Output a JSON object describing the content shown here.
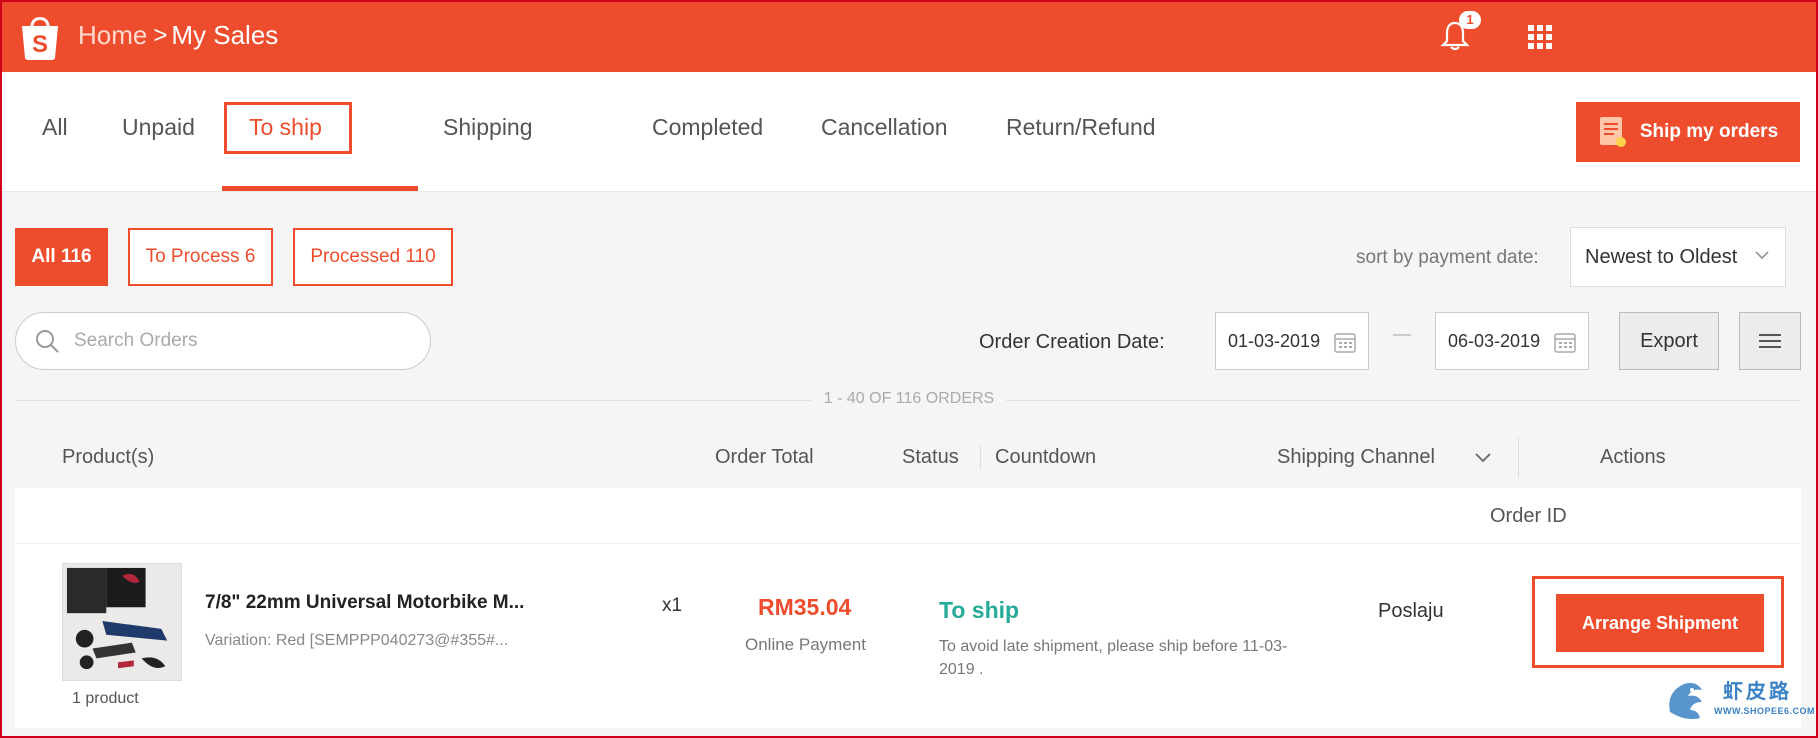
{
  "topbar": {
    "logo_letter": "S",
    "breadcrumb_home": "Home",
    "breadcrumb_separator": ">",
    "breadcrumb_current": "My Sales",
    "notification_count": "1",
    "brand_color": "#ee4d2d"
  },
  "tabs": [
    {
      "label": "All"
    },
    {
      "label": "Unpaid"
    },
    {
      "label": "To ship"
    },
    {
      "label": "Shipping"
    },
    {
      "label": "Completed"
    },
    {
      "label": "Cancellation"
    },
    {
      "label": "Return/Refund"
    }
  ],
  "active_tab": "To ship",
  "ship_orders_button": "Ship my orders",
  "filters": {
    "chips": [
      {
        "label": "All 116"
      },
      {
        "label": "To Process 6"
      },
      {
        "label": "Processed 110"
      }
    ],
    "sort_label": "sort by payment date:",
    "sort_value": "Newest to Oldest",
    "search_placeholder": "Search Orders",
    "date_label": "Order Creation Date:",
    "date_from": "01-03-2019",
    "date_to": "06-03-2019",
    "export_label": "Export"
  },
  "orders_count": "1 - 40 OF 116 ORDERS",
  "columns": {
    "product": "Product(s)",
    "order_total": "Order Total",
    "status": "Status",
    "countdown": "Countdown",
    "shipping_channel": "Shipping Channel",
    "actions": "Actions"
  },
  "order": {
    "order_id_label": "Order ID",
    "product_name": "7/8\" 22mm Universal Motorbike M...",
    "variation": "Variation: Red [SEMPPP040273@#355#...",
    "product_count": "1 product",
    "quantity": "x1",
    "total": "RM35.04",
    "payment_method": "Online Payment",
    "status": "To ship",
    "status_note": "To avoid late shipment, please ship before 11-03-2019 .",
    "shipping_channel": "Poslaju",
    "action_label": "Arrange Shipment",
    "status_color": "#26aa99"
  },
  "watermark": {
    "chinese": "虾皮路",
    "url": "WWW.SHOPEE6.COM"
  }
}
